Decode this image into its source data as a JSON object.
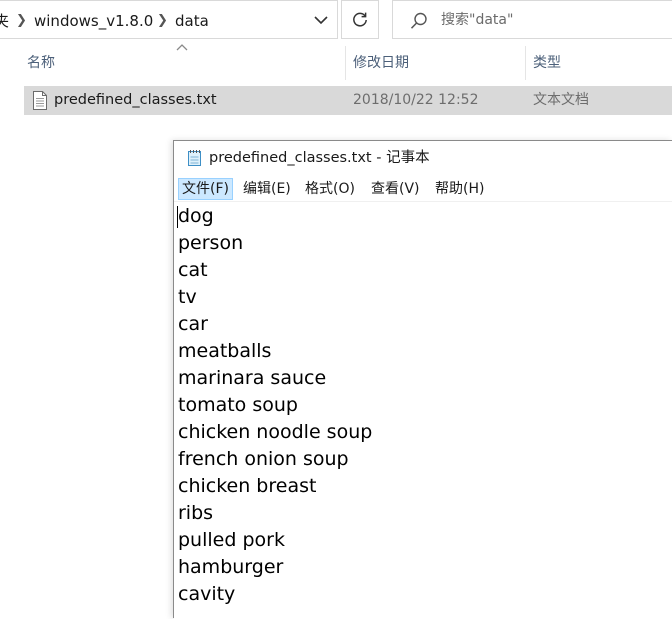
{
  "explorer": {
    "breadcrumb": {
      "parent_fragment": "夹",
      "folder": "windows_v1.8.0",
      "current": "data"
    },
    "search": {
      "placeholder": "搜索\"data\""
    },
    "columns": {
      "name": "名称",
      "modified": "修改日期",
      "type": "类型"
    },
    "files": [
      {
        "name": "predefined_classes.txt",
        "modified": "2018/10/22 12:52",
        "type": "文本文档"
      }
    ]
  },
  "notepad": {
    "title": "predefined_classes.txt - 记事本",
    "menu": [
      {
        "label": "文件(F)"
      },
      {
        "label": "编辑(E)"
      },
      {
        "label": "格式(O)"
      },
      {
        "label": "查看(V)"
      },
      {
        "label": "帮助(H)"
      }
    ],
    "lines": [
      "dog",
      "person",
      "cat",
      "tv",
      "car",
      "meatballs",
      "marinara sauce",
      "tomato soup",
      "chicken noodle soup",
      "french onion soup",
      "chicken breast",
      "ribs",
      "pulled pork",
      "hamburger",
      "cavity"
    ]
  },
  "colors": {
    "selection": "#d9d9d9",
    "header_text": "#4c607a",
    "menu_active_bg": "#cce8ff"
  }
}
